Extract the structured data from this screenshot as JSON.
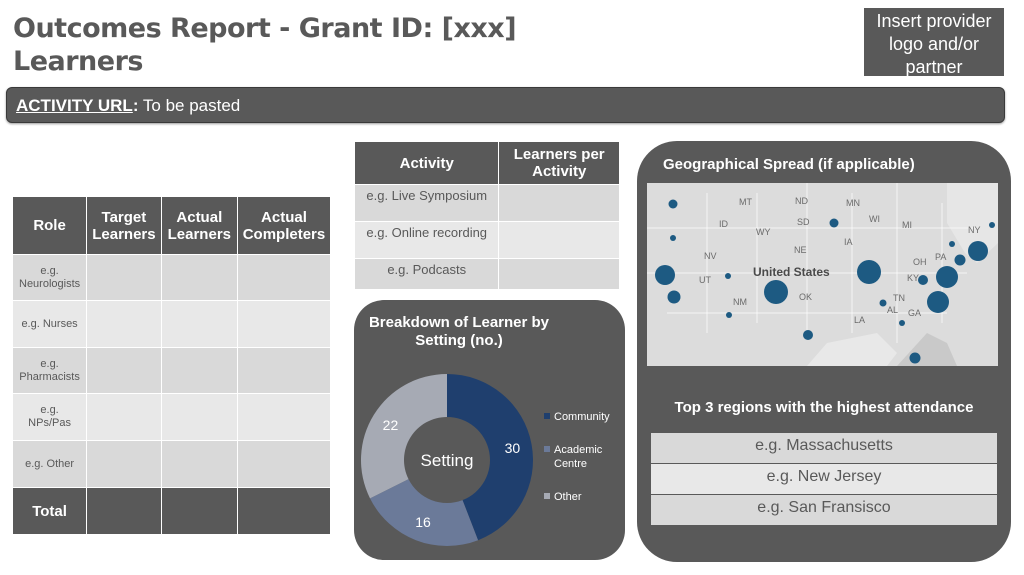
{
  "header": {
    "title_line1": "Outcomes Report - Grant ID: [xxx]",
    "title_line2": "Learners",
    "logo_placeholder": "Insert provider logo and/or partner"
  },
  "activity_url": {
    "label": "ACTIVITY URL",
    "colon": ":",
    "value": "To be pasted"
  },
  "role_table": {
    "headers": [
      "Role",
      "Target Learners",
      "Actual Learners",
      "Actual Completers"
    ],
    "rows": [
      {
        "role": "e.g. Neurologists"
      },
      {
        "role": "e.g. Nurses"
      },
      {
        "role": "e.g. Pharmacists"
      },
      {
        "role": "e.g. NPs/Pas"
      },
      {
        "role": "e.g. Other"
      }
    ],
    "total_label": "Total"
  },
  "activity_table": {
    "headers": [
      "Activity",
      "Learners per Activity"
    ],
    "rows": [
      "e.g. Live Symposium",
      "e.g. Online recording",
      "e.g. Podcasts"
    ]
  },
  "chart_data": {
    "type": "pie",
    "title": "Breakdown of Learner by Setting (no.)",
    "center_label": "Setting",
    "categories": [
      "Community",
      "Academic Centre",
      "Other"
    ],
    "values": [
      30,
      16,
      22
    ],
    "colors": [
      "#1f3f6e",
      "#6b7a99",
      "#a6aab4"
    ],
    "legend_position": "right"
  },
  "geo": {
    "title": "Geographical Spread (if applicable)",
    "map_label": "United States",
    "state_labels": [
      "MT",
      "ND",
      "SD",
      "WY",
      "NE",
      "NV",
      "OK",
      "NM",
      "IA",
      "MN",
      "WI",
      "MI",
      "OH",
      "PA",
      "NY",
      "KY",
      "TN",
      "AL",
      "GA",
      "SC",
      "LA",
      "ID",
      "UT"
    ],
    "top3_title": "Top 3 regions with the highest attendance",
    "top_regions": [
      "e.g. Massachusetts",
      "e.g. New Jersey",
      "e.g. San Fransisco"
    ]
  }
}
